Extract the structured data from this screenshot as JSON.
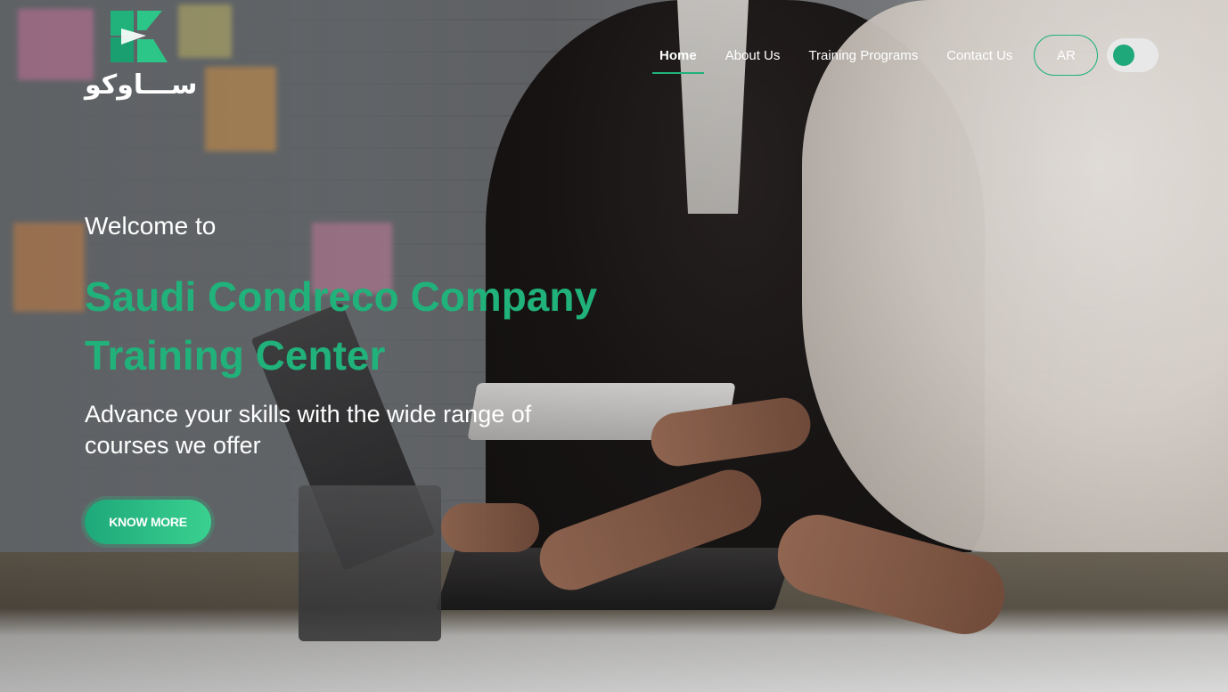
{
  "brand": {
    "logo_text": "ســـاوكو",
    "accent": "#20b27a"
  },
  "nav": {
    "items": [
      {
        "label": "Home",
        "active": true
      },
      {
        "label": "About Us",
        "active": false
      },
      {
        "label": "Training Programs",
        "active": false
      },
      {
        "label": "Contact Us",
        "active": false
      }
    ],
    "language_label": "AR",
    "theme_toggle": "toggle-icon"
  },
  "hero": {
    "welcome": "Welcome to",
    "headline": "Saudi Condreco Company Training Center",
    "subhead": "Advance your skills with the wide range of courses we offer",
    "cta_label": "KNOW MORE"
  }
}
